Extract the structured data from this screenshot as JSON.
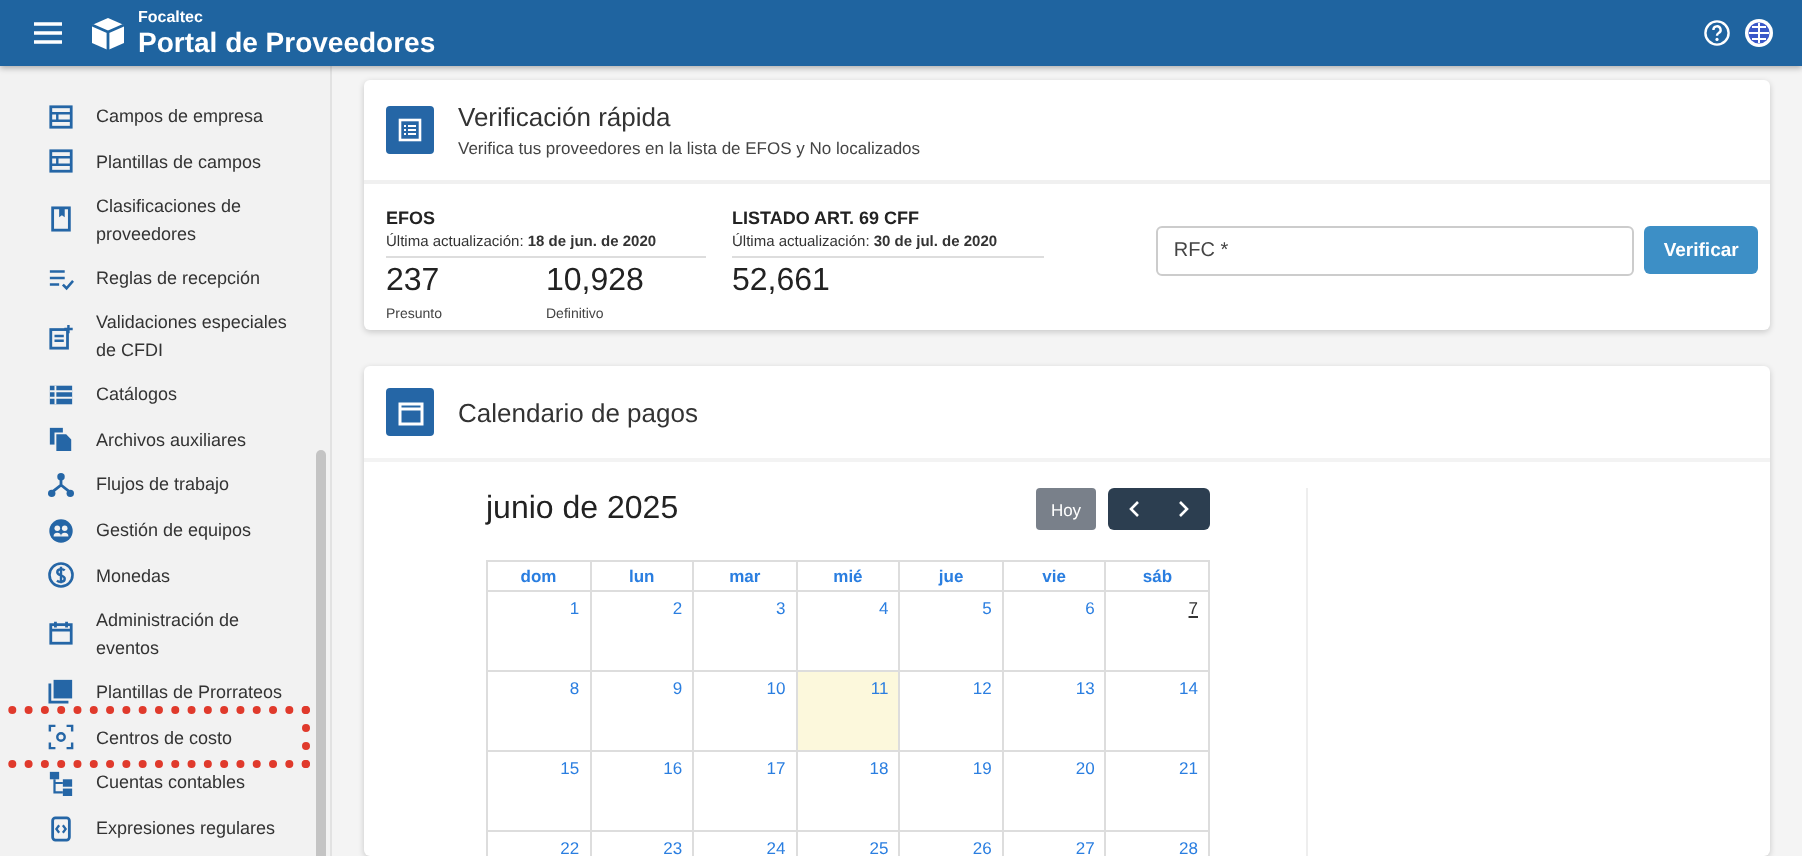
{
  "header": {
    "brand_small": "Focaltec",
    "brand_title": "Portal de Proveedores"
  },
  "sidebar": {
    "items": [
      {
        "label": "Campos de empresa",
        "highlighted": false
      },
      {
        "label": "Plantillas de campos",
        "highlighted": false
      },
      {
        "label": "Clasificaciones de proveedores",
        "highlighted": false
      },
      {
        "label": "Reglas de recepción",
        "highlighted": false
      },
      {
        "label": "Validaciones especiales de CFDI",
        "highlighted": false
      },
      {
        "label": "Catálogos",
        "highlighted": false
      },
      {
        "label": "Archivos auxiliares",
        "highlighted": false
      },
      {
        "label": "Flujos de trabajo",
        "highlighted": false
      },
      {
        "label": "Gestión de equipos",
        "highlighted": false
      },
      {
        "label": "Monedas",
        "highlighted": false
      },
      {
        "label": "Administración de eventos",
        "highlighted": false
      },
      {
        "label": "Plantillas de Prorrateos",
        "highlighted": false
      },
      {
        "label": "Centros de costo",
        "highlighted": true
      },
      {
        "label": "Cuentas contables",
        "highlighted": false
      },
      {
        "label": "Expresiones regulares",
        "highlighted": false
      }
    ]
  },
  "verification": {
    "title": "Verificación rápida",
    "subtitle": "Verifica tus proveedores en la lista de EFOS y No localizados",
    "lists": [
      {
        "title": "EFOS",
        "update_label": "Última actualización:",
        "update_date": "18 de jun. de 2020",
        "figures": [
          {
            "value": "237",
            "label": "Presunto"
          },
          {
            "value": "10,928",
            "label": "Definitivo"
          }
        ]
      },
      {
        "title": "LISTADO ART. 69 CFF",
        "update_label": "Última actualización:",
        "update_date": "30 de jul. de 2020",
        "figures": [
          {
            "value": "52,661"
          }
        ]
      }
    ],
    "rfc_field": {
      "placeholder": "RFC *"
    },
    "verify_button": "Verificar"
  },
  "calendar": {
    "title": "Calendario de pagos",
    "month_title": "junio de 2025",
    "today_button": "Hoy",
    "weekdays": [
      "dom",
      "lun",
      "mar",
      "mié",
      "jue",
      "vie",
      "sáb"
    ],
    "weeks": [
      [
        {
          "day": "1",
          "today": false,
          "focused": false
        },
        {
          "day": "2",
          "today": false,
          "focused": false
        },
        {
          "day": "3",
          "today": false,
          "focused": false
        },
        {
          "day": "4",
          "today": false,
          "focused": false
        },
        {
          "day": "5",
          "today": false,
          "focused": false
        },
        {
          "day": "6",
          "today": false,
          "focused": false
        },
        {
          "day": "7",
          "today": false,
          "focused": true
        }
      ],
      [
        {
          "day": "8",
          "today": false,
          "focused": false
        },
        {
          "day": "9",
          "today": false,
          "focused": false
        },
        {
          "day": "10",
          "today": false,
          "focused": false
        },
        {
          "day": "11",
          "today": true,
          "focused": false
        },
        {
          "day": "12",
          "today": false,
          "focused": false
        },
        {
          "day": "13",
          "today": false,
          "focused": false
        },
        {
          "day": "14",
          "today": false,
          "focused": false
        }
      ],
      [
        {
          "day": "15",
          "today": false,
          "focused": false
        },
        {
          "day": "16",
          "today": false,
          "focused": false
        },
        {
          "day": "17",
          "today": false,
          "focused": false
        },
        {
          "day": "18",
          "today": false,
          "focused": false
        },
        {
          "day": "19",
          "today": false,
          "focused": false
        },
        {
          "day": "20",
          "today": false,
          "focused": false
        },
        {
          "day": "21",
          "today": false,
          "focused": false
        }
      ],
      [
        {
          "day": "22",
          "today": false,
          "focused": false
        },
        {
          "day": "23",
          "today": false,
          "focused": false
        },
        {
          "day": "24",
          "today": false,
          "focused": false
        },
        {
          "day": "25",
          "today": false,
          "focused": false
        },
        {
          "day": "26",
          "today": false,
          "focused": false
        },
        {
          "day": "27",
          "today": false,
          "focused": false
        },
        {
          "day": "28",
          "today": false,
          "focused": false
        }
      ]
    ]
  }
}
